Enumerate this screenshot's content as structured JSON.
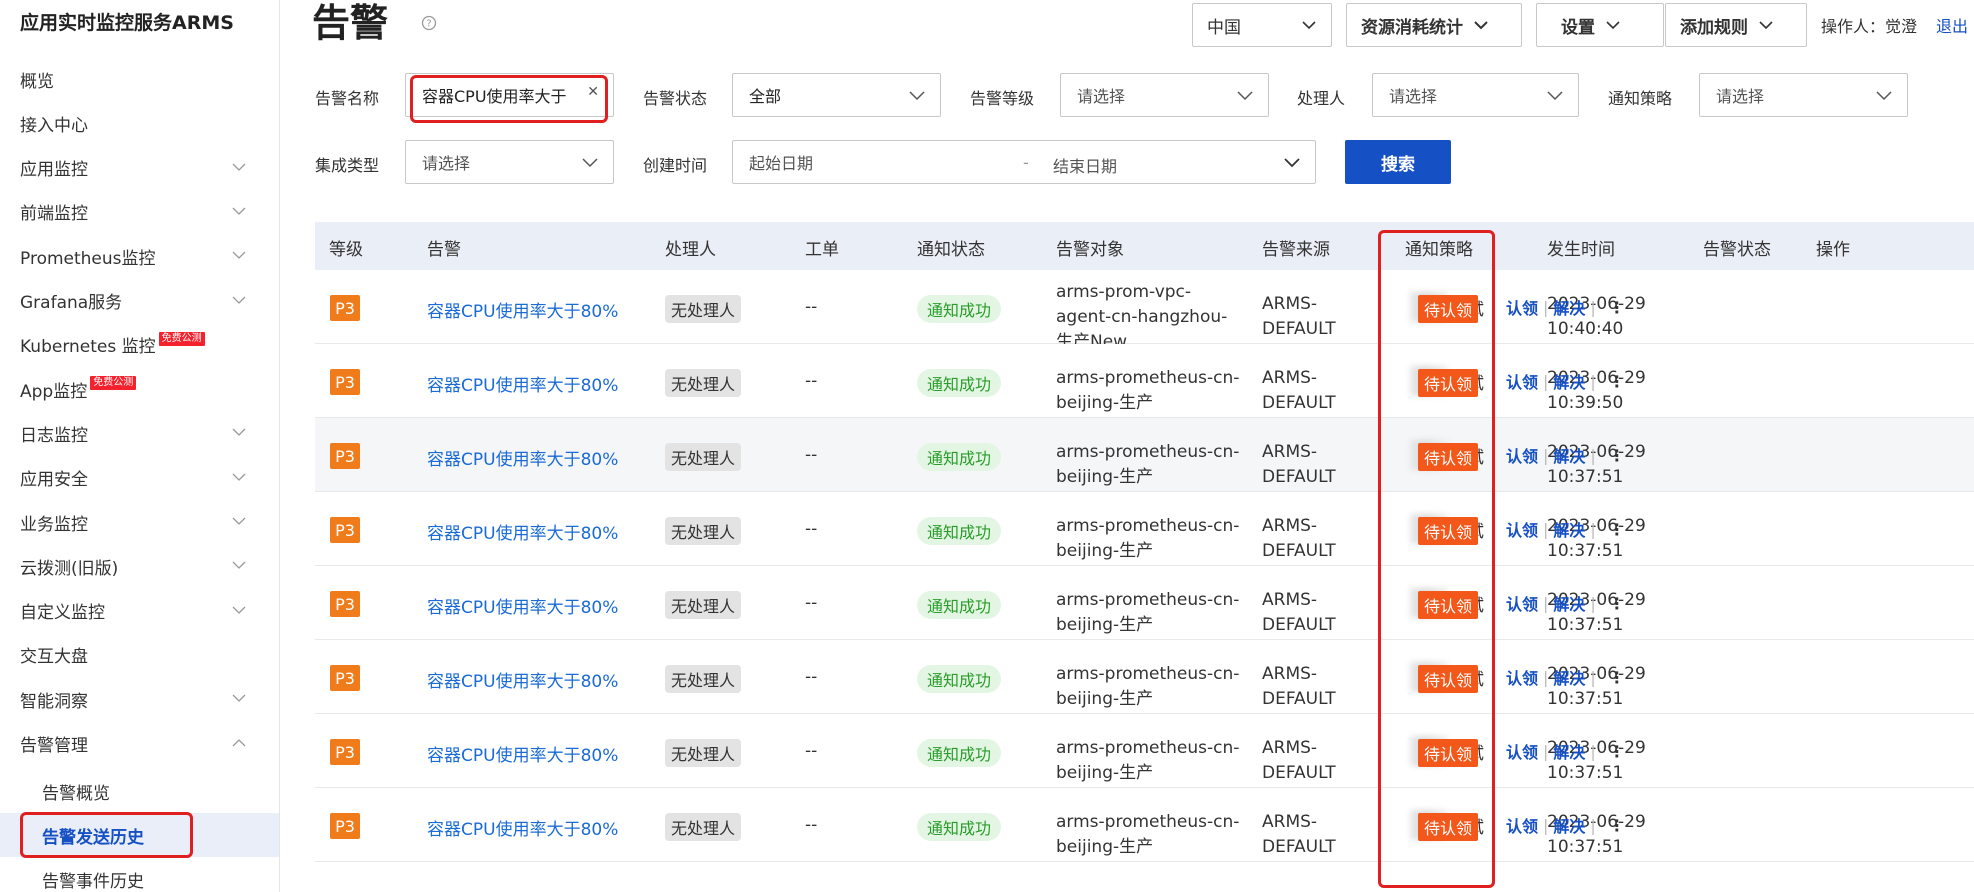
{
  "sidebar": {
    "title": "应用实时监控服务ARMS",
    "items": [
      {
        "label": "概览",
        "chevron": false,
        "badge": ""
      },
      {
        "label": "接入中心",
        "chevron": false,
        "badge": ""
      },
      {
        "label": "应用监控",
        "chevron": true,
        "badge": ""
      },
      {
        "label": "前端监控",
        "chevron": true,
        "badge": ""
      },
      {
        "label": "Prometheus监控",
        "chevron": true,
        "badge": ""
      },
      {
        "label": "Grafana服务",
        "chevron": true,
        "badge": ""
      },
      {
        "label": "Kubernetes 监控",
        "chevron": false,
        "badge": "免费公测"
      },
      {
        "label": "App监控",
        "chevron": false,
        "badge": "免费公测"
      },
      {
        "label": "日志监控",
        "chevron": true,
        "badge": ""
      },
      {
        "label": "应用安全",
        "chevron": true,
        "badge": ""
      },
      {
        "label": "业务监控",
        "chevron": true,
        "badge": ""
      },
      {
        "label": "云拨测(旧版)",
        "chevron": true,
        "badge": ""
      },
      {
        "label": "自定义监控",
        "chevron": true,
        "badge": ""
      },
      {
        "label": "交互大盘",
        "chevron": false,
        "badge": ""
      },
      {
        "label": "智能洞察",
        "chevron": true,
        "badge": ""
      },
      {
        "label": "告警管理",
        "chevron": "up",
        "badge": ""
      }
    ],
    "sub_items": [
      "告警概览",
      "告警发送历史",
      "告警事件历史"
    ]
  },
  "header": {
    "title": "告警",
    "region": "中国",
    "resource_stats": "资源消耗统计",
    "settings": "设置",
    "add_rule": "添加规则",
    "operator": "操作人：觉澄",
    "logout": "退出"
  },
  "filters": {
    "alarm_name_label": "告警名称",
    "alarm_name_value": "容器CPU使用率大于",
    "alarm_status_label": "告警状态",
    "alarm_status_value": "全部",
    "alarm_level_label": "告警等级",
    "alarm_level_placeholder": "请选择",
    "handler_label": "处理人",
    "handler_placeholder": "请选择",
    "policy_label": "通知策略",
    "policy_placeholder": "请选择",
    "integration_label": "集成类型",
    "integration_placeholder": "请选择",
    "created_label": "创建时间",
    "start_date": "起始日期",
    "date_sep": "-",
    "end_date": "结束日期",
    "search_button": "搜索"
  },
  "table": {
    "columns": [
      "等级",
      "告警",
      "处理人",
      "工单",
      "通知状态",
      "告警对象",
      "告警来源",
      "通知策略",
      "发生时间",
      "告警状态",
      "操作"
    ],
    "rows": [
      {
        "level": "P3",
        "alarm": "容器CPU使用率大于80%",
        "handler": "无处理人",
        "ticket": "--",
        "notify": "通知成功",
        "target": [
          "arms-prom-vpc-",
          "agent-cn-hangzhou-",
          "生产New"
        ],
        "source": [
          "ARMS-",
          "DEFAULT"
        ],
        "policy": "测试",
        "time": [
          "2023-06-29",
          "10:40:40"
        ],
        "status": "待认领"
      },
      {
        "level": "P3",
        "alarm": "容器CPU使用率大于80%",
        "handler": "无处理人",
        "ticket": "--",
        "notify": "通知成功",
        "target": [
          "arms-prometheus-cn-",
          "beijing-生产"
        ],
        "source": [
          "ARMS-",
          "DEFAULT"
        ],
        "policy": "测试",
        "time": [
          "2023-06-29",
          "10:39:50"
        ],
        "status": "待认领"
      },
      {
        "level": "P3",
        "alarm": "容器CPU使用率大于80%",
        "handler": "无处理人",
        "ticket": "--",
        "notify": "通知成功",
        "target": [
          "arms-prometheus-cn-",
          "beijing-生产"
        ],
        "source": [
          "ARMS-",
          "DEFAULT"
        ],
        "policy": "测试",
        "time": [
          "2023-06-29",
          "10:37:51"
        ],
        "status": "待认领"
      },
      {
        "level": "P3",
        "alarm": "容器CPU使用率大于80%",
        "handler": "无处理人",
        "ticket": "--",
        "notify": "通知成功",
        "target": [
          "arms-prometheus-cn-",
          "beijing-生产"
        ],
        "source": [
          "ARMS-",
          "DEFAULT"
        ],
        "policy": "测试",
        "time": [
          "2023-06-29",
          "10:37:51"
        ],
        "status": "待认领"
      },
      {
        "level": "P3",
        "alarm": "容器CPU使用率大于80%",
        "handler": "无处理人",
        "ticket": "--",
        "notify": "通知成功",
        "target": [
          "arms-prometheus-cn-",
          "beijing-生产"
        ],
        "source": [
          "ARMS-",
          "DEFAULT"
        ],
        "policy": "测试",
        "time": [
          "2023-06-29",
          "10:37:51"
        ],
        "status": "待认领"
      },
      {
        "level": "P3",
        "alarm": "容器CPU使用率大于80%",
        "handler": "无处理人",
        "ticket": "--",
        "notify": "通知成功",
        "target": [
          "arms-prometheus-cn-",
          "beijing-生产"
        ],
        "source": [
          "ARMS-",
          "DEFAULT"
        ],
        "policy": "测试",
        "time": [
          "2023-06-29",
          "10:37:51"
        ],
        "status": "待认领"
      },
      {
        "level": "P3",
        "alarm": "容器CPU使用率大于80%",
        "handler": "无处理人",
        "ticket": "--",
        "notify": "通知成功",
        "target": [
          "arms-prometheus-cn-",
          "beijing-生产"
        ],
        "source": [
          "ARMS-",
          "DEFAULT"
        ],
        "policy": "测试",
        "time": [
          "2023-06-29",
          "10:37:51"
        ],
        "status": "待认领"
      },
      {
        "level": "P3",
        "alarm": "容器CPU使用率大于80%",
        "handler": "无处理人",
        "ticket": "--",
        "notify": "通知成功",
        "target": [
          "arms-prometheus-cn-",
          "beijing-生产"
        ],
        "source": [
          "ARMS-",
          "DEFAULT"
        ],
        "policy": "测试",
        "time": [
          "2023-06-29",
          "10:37:51"
        ],
        "status": "待认领"
      }
    ],
    "actions": {
      "claim": "认领",
      "resolve": "解决",
      "more": "⋮"
    }
  },
  "colors": {
    "primary": "#1550c4",
    "level_badge": "#f07b1a",
    "pending_badge": "#f3571a",
    "notify_success": "#2a9c2a",
    "highlight_box": "#e02020"
  }
}
